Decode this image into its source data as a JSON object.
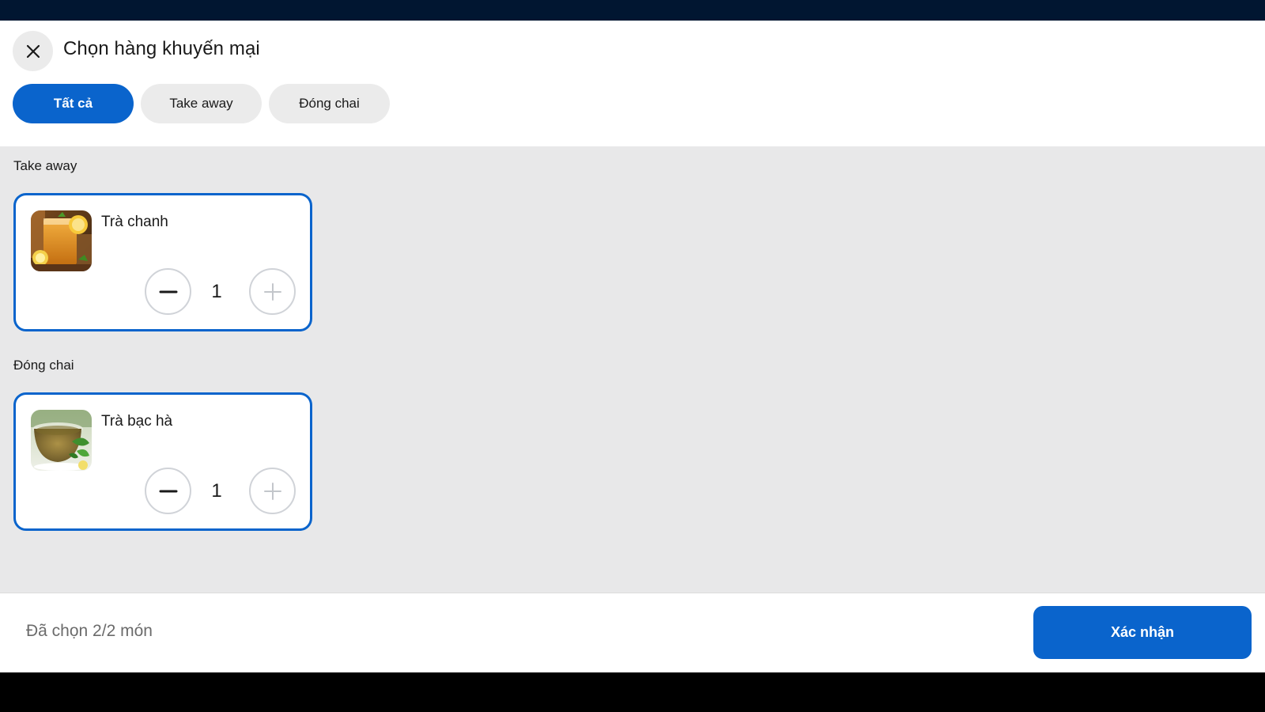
{
  "header": {
    "title": "Chọn hàng khuyến mại",
    "close_icon": "close-icon"
  },
  "filters": [
    {
      "label": "Tất cả",
      "active": true
    },
    {
      "label": "Take away",
      "active": false
    },
    {
      "label": "Đóng chai",
      "active": false
    }
  ],
  "sections": [
    {
      "title": "Take away",
      "items": [
        {
          "name": "Trà chanh",
          "quantity": "1",
          "image": "iced-lemon-tea-photo"
        }
      ]
    },
    {
      "title": "Đóng chai",
      "items": [
        {
          "name": "Trà bạc hà",
          "quantity": "1",
          "image": "mint-tea-photo"
        }
      ]
    }
  ],
  "footer": {
    "summary": "Đã chọn 2/2 món",
    "confirm_label": "Xác nhận"
  },
  "colors": {
    "accent": "#0a64cc",
    "status_bar": "#011631",
    "background": "#e8e8e9"
  }
}
